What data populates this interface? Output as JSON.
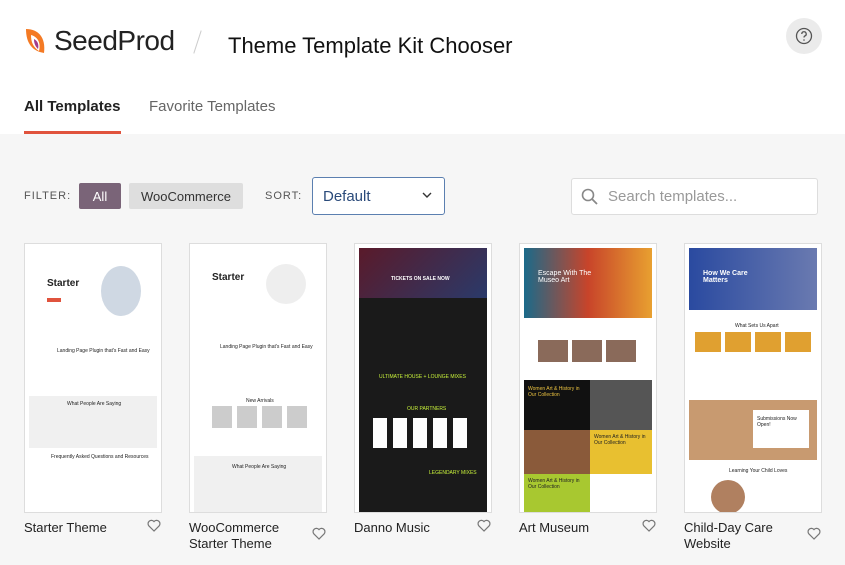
{
  "header": {
    "brand": "SeedProd",
    "title": "Theme Template Kit Chooser",
    "help_icon": "question-circle-icon"
  },
  "tabs": [
    {
      "label": "All Templates",
      "active": true
    },
    {
      "label": "Favorite Templates",
      "active": false
    }
  ],
  "filter": {
    "label": "FILTER:",
    "options": [
      {
        "label": "All",
        "active": true
      },
      {
        "label": "WooCommerce",
        "active": false
      }
    ]
  },
  "sort": {
    "label": "SORT:",
    "value": "Default"
  },
  "search": {
    "placeholder": "Search templates..."
  },
  "colors": {
    "accent": "#e0533d",
    "filter_active": "#7a6478",
    "filter_inactive": "#dedede",
    "sort_border": "#5b7fb0"
  },
  "templates": [
    {
      "name": "Starter Theme",
      "thumb_heading": "Starter",
      "thumb_sub": "Landing Page Plugin that's Fast and Easy",
      "thumb_section": "What People Are Saying",
      "thumb_faq": "Frequently Asked Questions and Resources"
    },
    {
      "name": "WooCommerce Starter Theme",
      "thumb_heading": "Starter",
      "thumb_sub": "Landing Page Plugin that's Fast and Easy",
      "thumb_section": "New Arrivals",
      "thumb_faq": "What People Are Saying"
    },
    {
      "name": "Danno Music",
      "thumb_heading": "TICKETS ON SALE NOW",
      "thumb_sub": "ULTIMATE HOUSE + LOUNGE MIXES",
      "thumb_section": "OUR PARTNERS",
      "thumb_faq": "LEGENDARY MIXES"
    },
    {
      "name": "Art Museum",
      "thumb_heading": "Escape With The Museo Art",
      "thumb_sub": "Women Art & History in Our Collection",
      "thumb_section": "Women Art & History in Our Collection",
      "thumb_faq": "Women Art & History in Our Collection"
    },
    {
      "name": "Child-Day Care Website",
      "thumb_heading": "How We Care Matters",
      "thumb_sub": "What Sets Us Apart",
      "thumb_section": "Submissions Now Open!",
      "thumb_faq": "Learning Your Child Loves"
    }
  ]
}
